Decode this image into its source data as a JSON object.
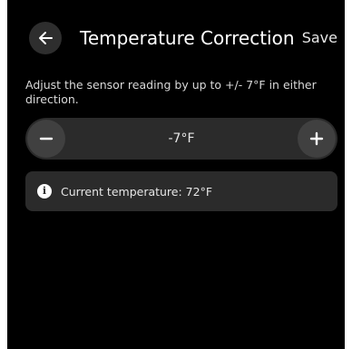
{
  "header": {
    "back_icon": "arrow-left-icon",
    "title": "Temperature Correction",
    "save_label": "Save"
  },
  "description": "Adjust the sensor reading by up to  +/- 7°F in either direction.",
  "stepper": {
    "minus_icon": "minus-icon",
    "plus_icon": "plus-icon",
    "value": "-7°F"
  },
  "info": {
    "icon": "info-icon",
    "text": "Current temperature:  72°F"
  },
  "colors": {
    "background": "#000000",
    "surface": "#2b2b2b",
    "button": "#404040",
    "text": "#ffffff"
  }
}
